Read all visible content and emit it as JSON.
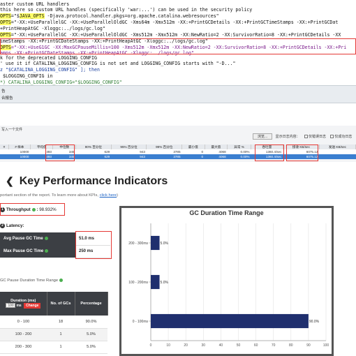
{
  "code_lines": [
    {
      "id": "l0",
      "parts": [
        {
          "t": "aster custom URL handlers",
          "c": ""
        }
      ]
    },
    {
      "id": "l1",
      "parts": [
        {
          "t": "this here so custom URL handles (specifically 'war:...') can be used in the security policy",
          "c": ""
        }
      ]
    },
    {
      "id": "l2",
      "parts": [
        {
          "t": "OPTS",
          "c": "hl"
        },
        {
          "t": "=\"$",
          "c": ""
        },
        {
          "t": "JAVA_OPTS",
          "c": "hl"
        },
        {
          "t": " -Djava.protocol.handler.pkgs=org.apache.catalina.webresources\"",
          "c": ""
        }
      ]
    },
    {
      "id": "l3",
      "parts": [
        {
          "t": "OPTS",
          "c": "hl"
        },
        {
          "t": "=\"-XX:+UseParallelGC -XX:+UseParallelOldGC -Xms64m -Xmx512m -XX:+PrintGCDetails -XX:+PrintGCTimeStamps -XX:+PrintGCDat",
          "c": ""
        }
      ]
    },
    {
      "id": "l4",
      "parts": [
        {
          "t": "+PrintHeapAtGC -Xloggc:../logs/gc.log\"",
          "c": ""
        }
      ]
    },
    {
      "id": "l5",
      "parts": [
        {
          "t": "OPTS",
          "c": "hl"
        },
        {
          "t": "=\"-XX:+UseParallelGC -XX:+UseParallelOldGC -Xms512m -Xmx512m -XX:NewRatio=2 -XX:SurvivorRatio=8 -XX:+PrintGCDetails -XX",
          "c": ""
        }
      ]
    },
    {
      "id": "l6",
      "parts": [
        {
          "t": "imeStamps -XX:+PrintGCDateStamps -XX:+PrintHeapAtGC -Xloggc:../logs/gc.log\"",
          "c": ""
        }
      ]
    },
    {
      "id": "l7",
      "parts": [
        {
          "t": "OPTS",
          "c": "hl"
        },
        {
          "t": "=\"-XX:+UseG1GC -XX:MaxGCPauseMillis=100 -Xms512m -Xmx512m -XX:NewRatio=2 -XX:SurvivorRatio=8 -XX:+PrintGCDetails -XX:+Pri",
          "c": "pu"
        }
      ]
    },
    {
      "id": "l8",
      "parts": [
        {
          "t": "amps -XX:+PrintGCDateStamps -XX:+PrintHeapAtGC -Xloggc:../logs/gc.log\"",
          "c": "pu"
        }
      ]
    },
    {
      "id": "l9",
      "parts": [
        {
          "t": "k for the deprecated LOGGING_CONFIG",
          "c": ""
        }
      ]
    },
    {
      "id": "l10",
      "parts": [
        {
          "t": "' use it if CATALINA_LOGGING_CONFIG is not set and LOGGING_CONFIG starts with \"-D...\"",
          "c": ""
        }
      ]
    },
    {
      "id": "l11",
      "parts": [
        {
          "t": "z \"$CATALINA_LOGGING_CONFIG\" ]; then",
          "c": "bl"
        }
      ]
    },
    {
      "id": "l12",
      "parts": [
        {
          "t": " $LOGGING_CONFIG in",
          "c": ""
        }
      ]
    },
    {
      "id": "l13",
      "parts": [
        {
          "t": "*) CATALINA_LOGGING_CONFIG=\"$LOGGING_CONFIG\"",
          "c": "gr"
        }
      ]
    }
  ],
  "band": {
    "line1": "告",
    "line2": "合报告"
  },
  "panel": {
    "header": "写入一个文件",
    "browse": "浏览...",
    "opt1": "显示日志内容：",
    "opt2": "仅错误日志",
    "opt3": "仅成功日志"
  },
  "agg_table": {
    "headers": [
      "#",
      "# 样本",
      "平均值",
      "中位数",
      "90% 百分位",
      "95% 百分位",
      "99% 百分位",
      "最小值",
      "最大值",
      "异常 %",
      "吞吐量",
      "接收 KB/sec",
      "发送 KB/sec"
    ],
    "rows": [
      [
        "",
        "10000",
        "493",
        "345",
        "629",
        "943",
        "3785",
        "0",
        "4068",
        "0.00%",
        "1360.4/sec",
        "6075.12",
        ""
      ],
      [
        "",
        "10000",
        "493",
        "345",
        "629",
        "943",
        "3785",
        "0",
        "4068",
        "0.00%",
        "1360.4/sec",
        "6075.12",
        ""
      ]
    ]
  },
  "kpi": {
    "title": "Key Performance Indicators",
    "subtitle_prefix": "portant section of the report. To learn more about KPIs, ",
    "subtitle_link": "click here",
    "subtitle_suffix": ")",
    "throughput_label": "Throughput",
    "throughput_value": "98.932%",
    "latency_label": "Latency:",
    "avg_pause_label": "Avg Pause GC Time",
    "avg_pause_value": "51.0 ms",
    "max_pause_label": "Max Pause GC Time",
    "max_pause_value": "250 ms",
    "gc_range_label": "GC Pause Duration Time Range"
  },
  "duration_table": {
    "headers": [
      "Duration (ms)",
      "No. of GCs",
      "Percentage"
    ],
    "input_value": "100",
    "input_unit": "ms",
    "change_btn": "Change",
    "rows": [
      [
        "0 - 100",
        "18",
        "90.0%"
      ],
      [
        "100 - 200",
        "1",
        "5.0%"
      ],
      [
        "200 - 300",
        "1",
        "5.0%"
      ]
    ]
  },
  "chart_data": {
    "type": "bar",
    "orientation": "horizontal",
    "title": "GC Duration Time Range",
    "categories": [
      "200 - 300ms",
      "100 - 200ms",
      "0 - 100ms"
    ],
    "values": [
      5.0,
      5.0,
      90.0
    ],
    "data_labels": [
      "5.0%",
      "5.0%",
      "90.0%"
    ],
    "xlim": [
      0,
      100
    ],
    "xticks": [
      0,
      10,
      20,
      30,
      40,
      50,
      60,
      70,
      80,
      90,
      100
    ],
    "grid": true,
    "bar_color": "#1f2f6e"
  },
  "colors": {
    "highlight_box": "#e53935",
    "selected_row": "#3b7fd0"
  }
}
